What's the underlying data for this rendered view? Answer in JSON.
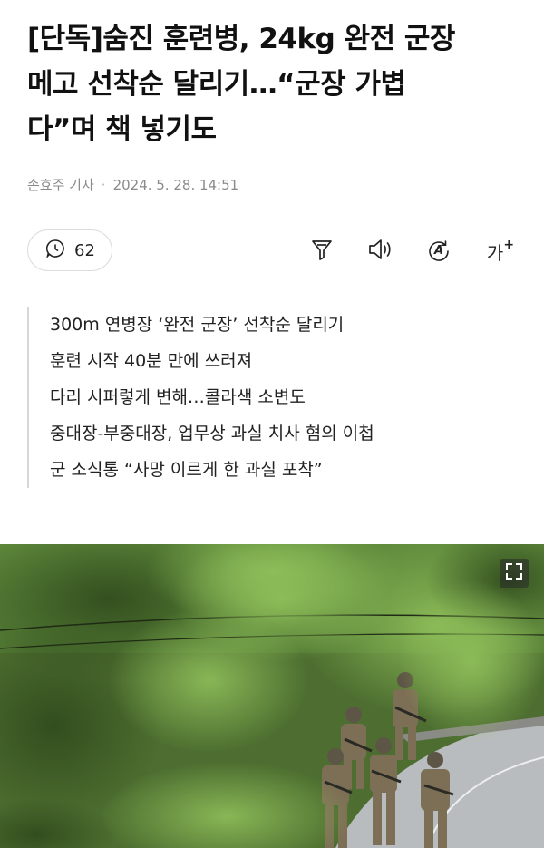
{
  "article": {
    "title_lines": [
      "[단독]숨진 훈련병, 24kg 완전 군장",
      "메고 선착순 달리기…“군장 가볍",
      "다”며 책 넣기도"
    ],
    "reporter": "손효주 기자",
    "separator": "·",
    "datetime": "2024. 5. 28. 14:51"
  },
  "toolbar": {
    "comment_count": "62",
    "icons": [
      "comment-clock-icon",
      "summary-filter-icon",
      "speaker-icon",
      "translate-icon",
      "font-size-icon"
    ],
    "font_size_label": "가",
    "font_size_plus": "+",
    "translate_letter": "A"
  },
  "summary": {
    "lines": [
      "300m 연병장 ‘완전 군장’ 선착순 달리기",
      "훈련 시작 40분 만에 쓰러져",
      "다리 시퍼렇게 변해…콜라색 소변도",
      "중대장-부중대장, 업무상 과실 치사 혐의 이첩",
      "군 소식통 “사망 이르게 한 과실 포착”"
    ]
  },
  "photo": {
    "subject": "soldiers marching on forest road",
    "expand_icon": "expand-icon"
  },
  "colors": {
    "text": "#111111",
    "meta": "#8a8a8a",
    "border": "#d7d7d7",
    "foliage": "#4f7a33"
  }
}
